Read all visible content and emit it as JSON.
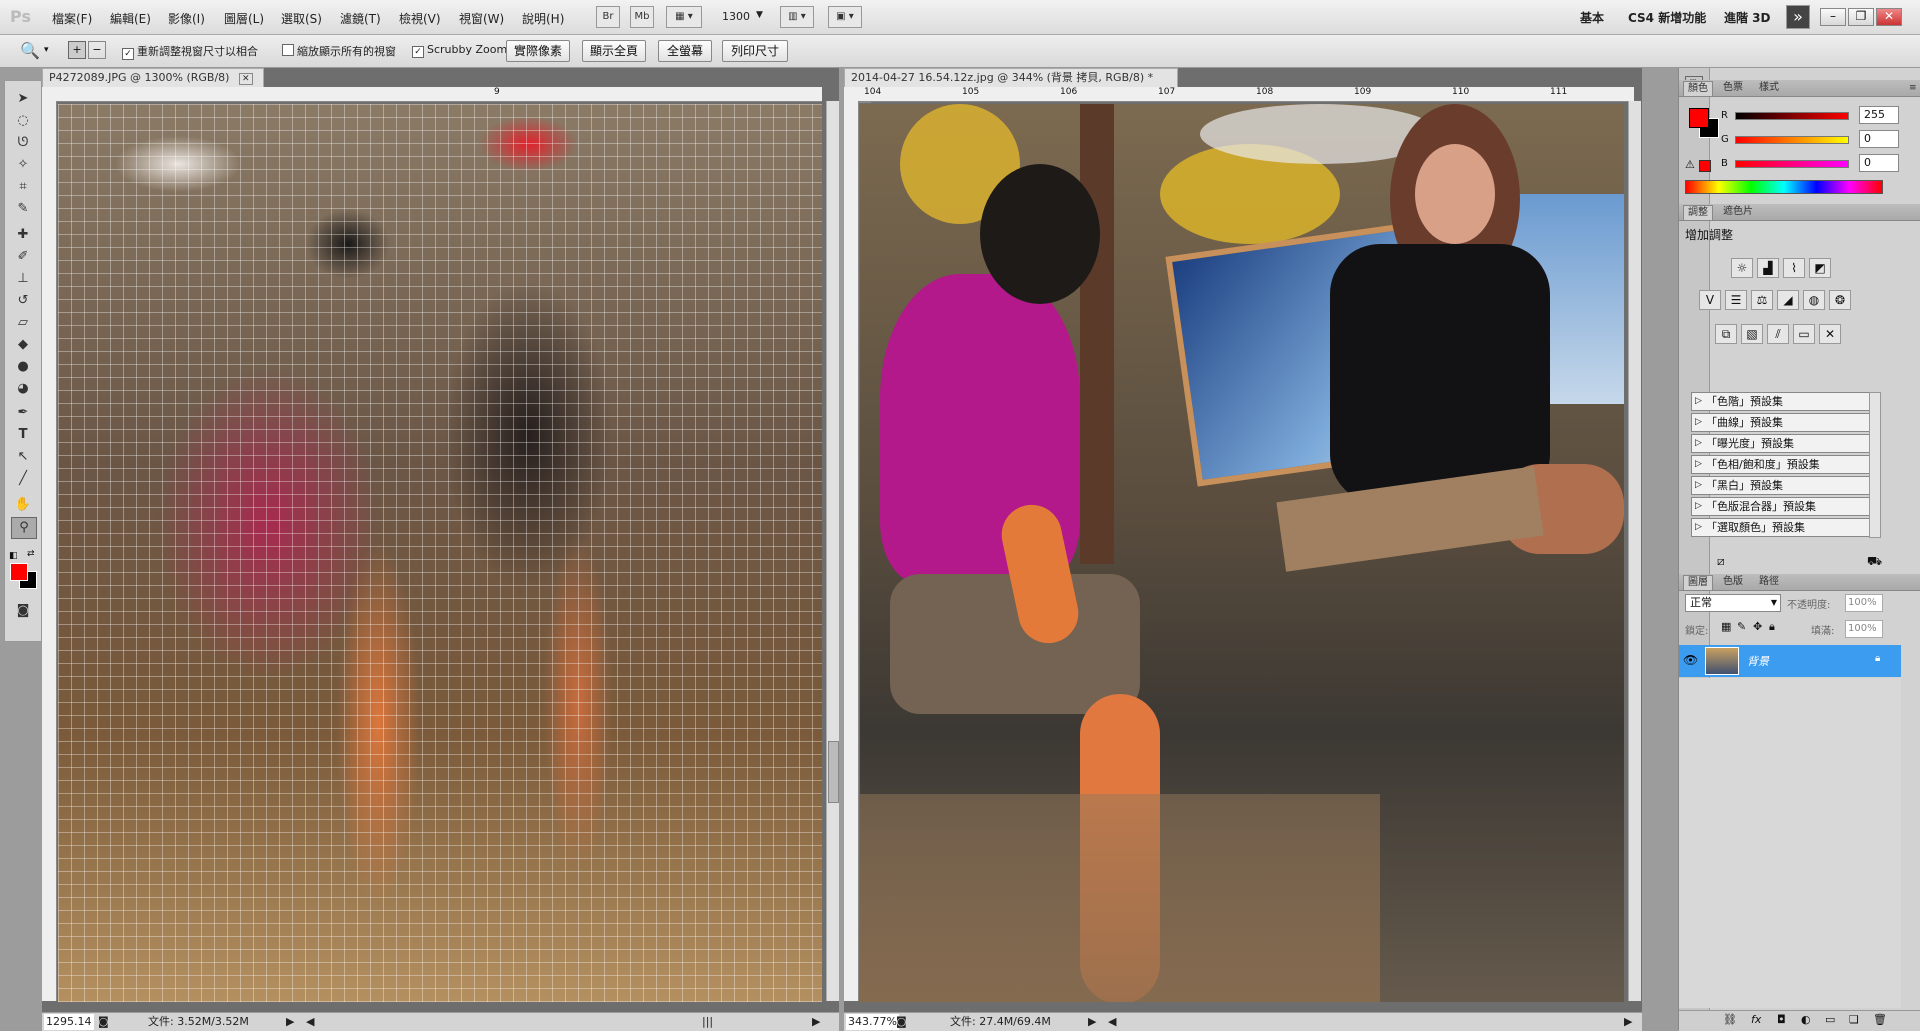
{
  "menubar": {
    "logo": "Ps",
    "items": [
      "檔案(F)",
      "編輯(E)",
      "影像(I)",
      "圖層(L)",
      "選取(S)",
      "濾鏡(T)",
      "檢視(V)",
      "視窗(W)",
      "說明(H)"
    ],
    "bridge_btn": "Br",
    "minibridge_btn": "Mb",
    "zoom_value": "1300",
    "workspaces": [
      "基本",
      "CS4 新增功能",
      "進階 3D"
    ],
    "more": "»"
  },
  "options": {
    "resize_windows": "重新調整視窗尺寸以相合",
    "zoom_all": "縮放顯示所有的視窗",
    "scrubby": "Scrubby Zoom",
    "btn_actual": "實際像素",
    "btn_fit": "顯示全頁",
    "btn_fill": "全螢幕",
    "btn_print": "列印尺寸"
  },
  "doc1": {
    "title": "P4272089.JPG @ 1300% (RGB/8)",
    "ruler_label": "9",
    "zoom": "1295.14",
    "file_info": "文件: 3.52M/3.52M"
  },
  "doc2": {
    "title": "2014-04-27 16.54.12z.jpg @ 344% (背景 拷貝, RGB/8) *",
    "ruler_labels": [
      "104",
      "105",
      "106",
      "107",
      "108",
      "109",
      "110",
      "111"
    ],
    "zoom": "343.77%",
    "file_info": "文件: 27.4M/69.4M"
  },
  "color_panel": {
    "tabs": [
      "顏色",
      "色票",
      "樣式"
    ],
    "r_label": "R",
    "r_value": "255",
    "g_label": "G",
    "g_value": "0",
    "b_label": "B",
    "b_value": "0",
    "fg_color": "#ff0000",
    "bg_color": "#000000"
  },
  "adjust_panel": {
    "tabs": [
      "調整",
      "遮色片"
    ],
    "title": "增加調整",
    "presets": [
      "「色階」預設集",
      "「曲線」預設集",
      "「曝光度」預設集",
      "「色相/飽和度」預設集",
      "「黑白」預設集",
      "「色版混合器」預設集",
      "「選取顏色」預設集"
    ]
  },
  "layers_panel": {
    "tabs": [
      "圖層",
      "色版",
      "路徑"
    ],
    "blend_mode": "正常",
    "opacity_label": "不透明度:",
    "opacity_value": "100%",
    "lock_label": "鎖定:",
    "fill_label": "填滿:",
    "fill_value": "100%",
    "layer_name": "背景"
  }
}
